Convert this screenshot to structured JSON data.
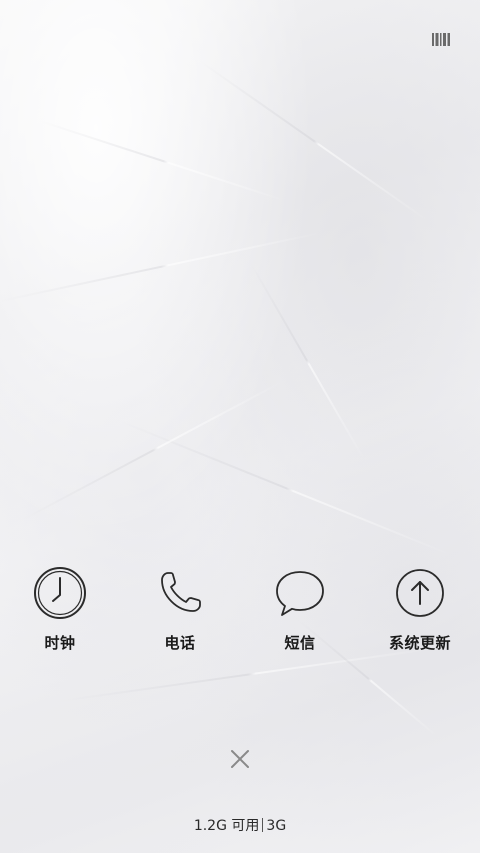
{
  "status_bar": {
    "icon": "barcode-icon"
  },
  "apps": [
    {
      "label": "时钟",
      "icon": "clock-icon"
    },
    {
      "label": "电话",
      "icon": "phone-icon"
    },
    {
      "label": "短信",
      "icon": "message-icon"
    },
    {
      "label": "系统更新",
      "icon": "update-arrow-icon"
    }
  ],
  "close_button": {
    "icon": "close-icon"
  },
  "memory": {
    "available": "1.2G 可用",
    "total": "3G"
  },
  "colors": {
    "icon_stroke": "#2b2b2b",
    "label_text": "#1a1a1a",
    "close_icon": "#8a8a8a"
  }
}
